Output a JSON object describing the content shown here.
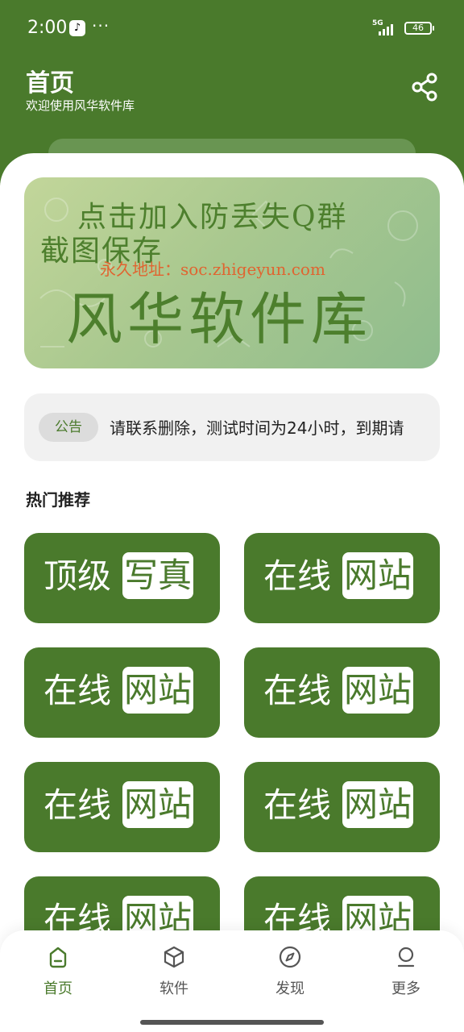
{
  "status_bar": {
    "time": "2:00",
    "more_dots": "···",
    "network": "5G",
    "battery": "46"
  },
  "header": {
    "title": "首页",
    "subtitle": "欢迎使用风华软件库",
    "share_icon": "share-icon"
  },
  "banner": {
    "line1": "点击加入防丢失Q群",
    "line2": "截图保存",
    "line3": "永久地址：soc.zhigeyun.com",
    "line4": "风华软件库"
  },
  "notice": {
    "tag": "公告",
    "text": "请联系删除，测试时间为24小时，到期请"
  },
  "section": {
    "title": "热门推荐"
  },
  "cards": [
    {
      "left": "顶级",
      "right": "写真"
    },
    {
      "left": "在线",
      "right": "网站"
    },
    {
      "left": "在线",
      "right": "网站"
    },
    {
      "left": "在线",
      "right": "网站"
    },
    {
      "left": "在线",
      "right": "网站"
    },
    {
      "left": "在线",
      "right": "网站"
    },
    {
      "left": "在线",
      "right": "网站"
    },
    {
      "left": "在线",
      "right": "网站"
    }
  ],
  "bottom_nav": {
    "items": [
      {
        "label": "首页",
        "icon": "home-icon",
        "active": true
      },
      {
        "label": "软件",
        "icon": "cube-icon",
        "active": false
      },
      {
        "label": "发现",
        "icon": "compass-icon",
        "active": false
      },
      {
        "label": "更多",
        "icon": "person-icon",
        "active": false
      }
    ]
  },
  "colors": {
    "brand": "#4a7a2c",
    "banner_text": "#4d7f2d",
    "banner_accent": "#e06430"
  }
}
